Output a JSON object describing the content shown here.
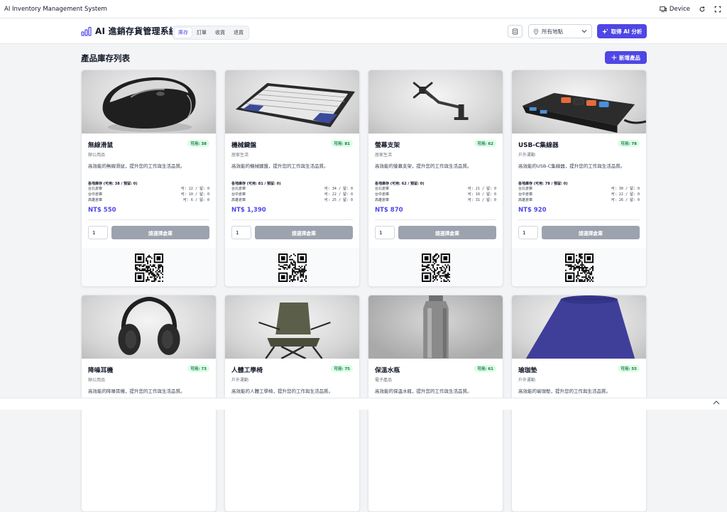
{
  "appbar": {
    "title": "AI Inventory Management System",
    "device_label": "Device"
  },
  "header": {
    "brand_title": "AI 進銷存貨管理系統",
    "tabs": [
      {
        "label": "庫存",
        "active": true
      },
      {
        "label": "訂單",
        "active": false
      },
      {
        "label": "收貨",
        "active": false
      },
      {
        "label": "退貨",
        "active": false
      }
    ],
    "location_select": "所有地點",
    "ai_button": "取得 AI 分析"
  },
  "list": {
    "title": "產品庫存列表",
    "add_button": "新增產品"
  },
  "products": [
    {
      "name": "無線滑鼠",
      "category": "辦公用品",
      "badge": "可用: 38",
      "desc": "高效能的無線滑鼠，提升您的工作與生活品質。",
      "stock_head": "各地庫存 (可用: 38 / 預留: 0)",
      "stock": [
        {
          "loc": "台北倉庫",
          "vals": "可: 22 / 留: 0"
        },
        {
          "loc": "台中倉庫",
          "vals": "可: 10 / 留: 0"
        },
        {
          "loc": "高雄倉庫",
          "vals": "可: 6 / 留: 0"
        }
      ],
      "price": "NT$ 550",
      "qty": "1",
      "select_label": "請選擇倉庫"
    },
    {
      "name": "機械鍵盤",
      "category": "居家生活",
      "badge": "可用: 81",
      "desc": "高效能的機械鍵盤，提升您的工作與生活品質。",
      "stock_head": "各地庫存 (可用: 81 / 預留: 0)",
      "stock": [
        {
          "loc": "台北倉庫",
          "vals": "可: 34 / 留: 0"
        },
        {
          "loc": "台中倉庫",
          "vals": "可: 22 / 留: 0"
        },
        {
          "loc": "高雄倉庫",
          "vals": "可: 25 / 留: 0"
        }
      ],
      "price": "NT$ 1,390",
      "qty": "1",
      "select_label": "請選擇倉庫"
    },
    {
      "name": "螢幕支架",
      "category": "居家生活",
      "badge": "可用: 62",
      "desc": "高效能的螢幕支架，提升您的工作與生活品質。",
      "stock_head": "各地庫存 (可用: 62 / 預留: 0)",
      "stock": [
        {
          "loc": "台北倉庫",
          "vals": "可: 21 / 留: 0"
        },
        {
          "loc": "台中倉庫",
          "vals": "可: 10 / 留: 0"
        },
        {
          "loc": "高雄倉庫",
          "vals": "可: 31 / 留: 0"
        }
      ],
      "price": "NT$ 870",
      "qty": "1",
      "select_label": "請選擇倉庫"
    },
    {
      "name": "USB-C集線器",
      "category": "戶外運動",
      "badge": "可用: 78",
      "desc": "高效能的USB-C集線器，提升您的工作與生活品質。",
      "stock_head": "各地庫存 (可用: 78 / 預留: 0)",
      "stock": [
        {
          "loc": "台北倉庫",
          "vals": "可: 30 / 留: 0"
        },
        {
          "loc": "台中倉庫",
          "vals": "可: 22 / 留: 0"
        },
        {
          "loc": "高雄倉庫",
          "vals": "可: 26 / 留: 0"
        }
      ],
      "price": "NT$ 920",
      "qty": "1",
      "select_label": "請選擇倉庫"
    },
    {
      "name": "降噪耳機",
      "category": "辦公用品",
      "badge": "可用: 73",
      "desc": "高效能的降噪耳機，提升您的工作與生活品質。"
    },
    {
      "name": "人體工學椅",
      "category": "戶外運動",
      "badge": "可用: 75",
      "desc": "高效能的人體工學椅，提升您的工作與生活品質。"
    },
    {
      "name": "保溫水瓶",
      "category": "電子產品",
      "badge": "可用: 61",
      "desc": "高效能的保溫水瓶，提升您的工作與生活品質。"
    },
    {
      "name": "瑜珈墊",
      "category": "戶外運動",
      "badge": "可用: 55",
      "desc": "高效能的瑜珈墊，提升您的工作與生活品質。"
    }
  ],
  "colors": {
    "accent": "#4f46e5",
    "badge_bg": "#dcfce7",
    "badge_text": "#15803d",
    "disabled_btn": "#9ca3af"
  }
}
